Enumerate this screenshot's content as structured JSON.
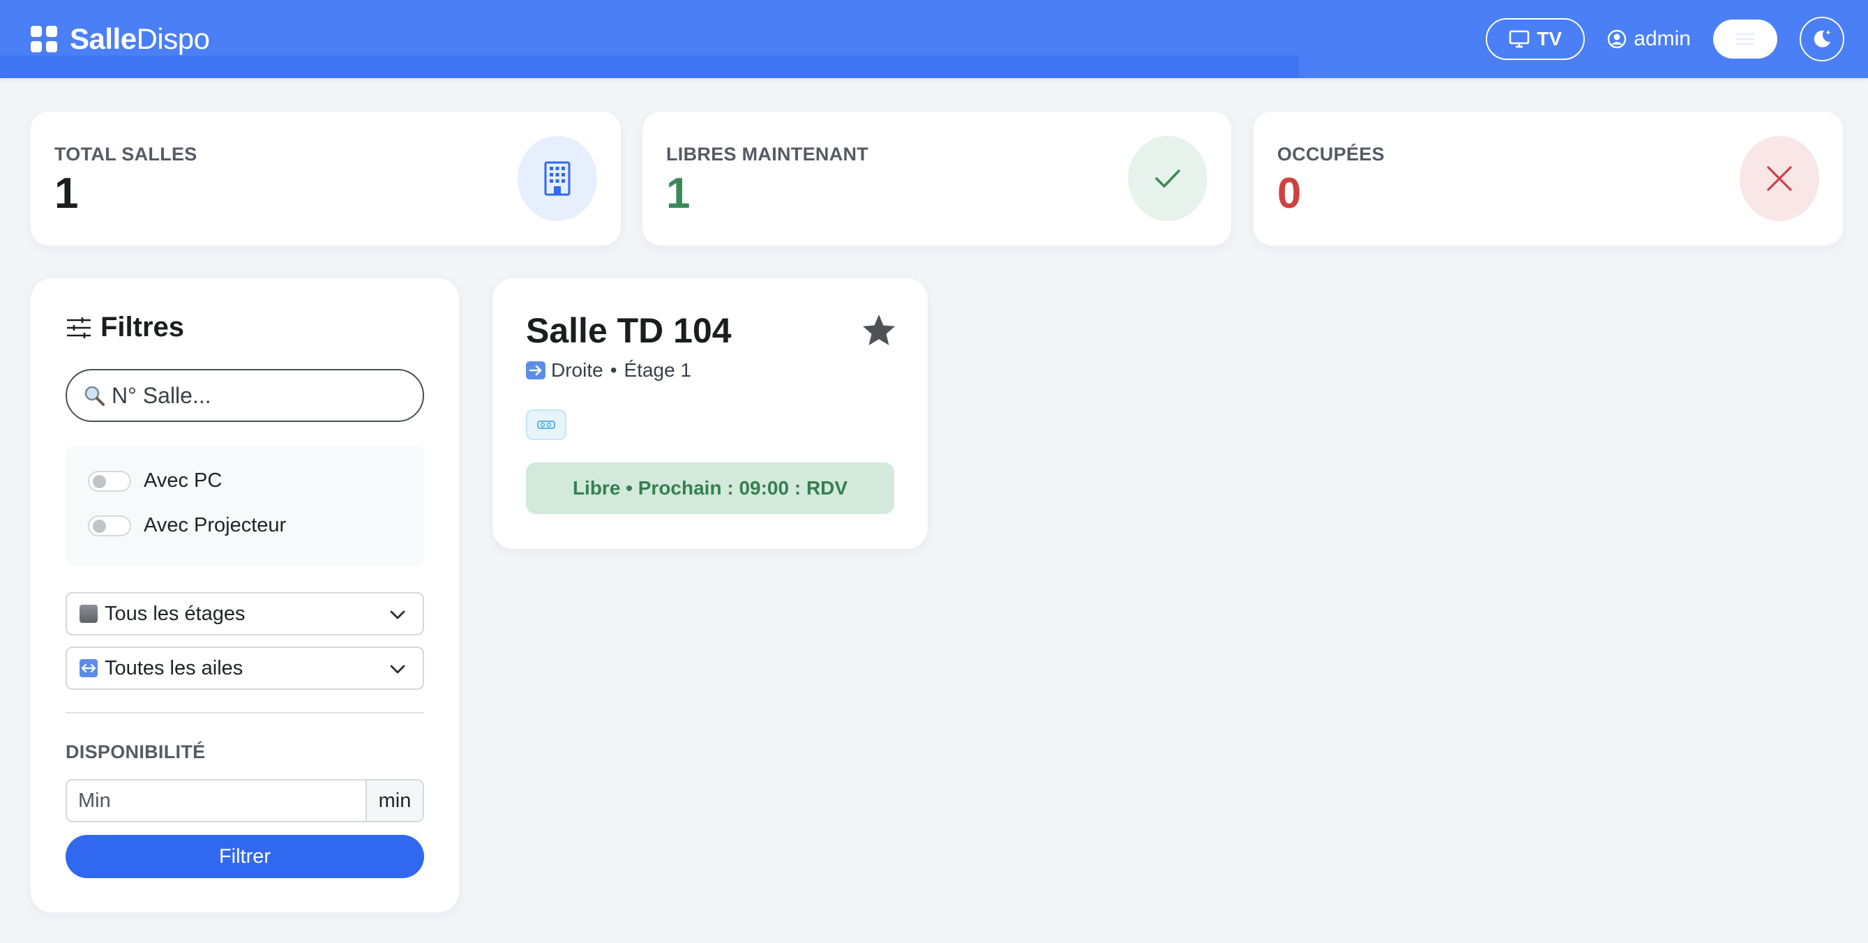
{
  "app": {
    "brand_bold": "Salle",
    "brand_light": "Dispo"
  },
  "header": {
    "tv_label": "TV",
    "user_label": "admin"
  },
  "stats": [
    {
      "label": "TOTAL SALLES",
      "value": "1"
    },
    {
      "label": "LIBRES MAINTENANT",
      "value": "1"
    },
    {
      "label": "OCCUPÉES",
      "value": "0"
    }
  ],
  "filters": {
    "title": "Filtres",
    "search_placeholder": "N° Salle...",
    "toggle_pc": "Avec PC",
    "toggle_projector": "Avec Projecteur",
    "floor_select": "Tous les étages",
    "wing_select": "Toutes les ailes",
    "availability_label": "DISPONIBILITÉ",
    "min_placeholder": "Min",
    "min_suffix": "min",
    "submit_label": "Filtrer"
  },
  "room": {
    "name": "Salle TD 104",
    "wing": "Droite",
    "separator": "•",
    "floor": "Étage 1",
    "status": "Libre • Prochain : 09:00 : RDV"
  },
  "colors": {
    "navbar": "#4a7ff5",
    "primary": "#3069f0",
    "free": "#3a8a55",
    "occupied": "#cf4141"
  }
}
